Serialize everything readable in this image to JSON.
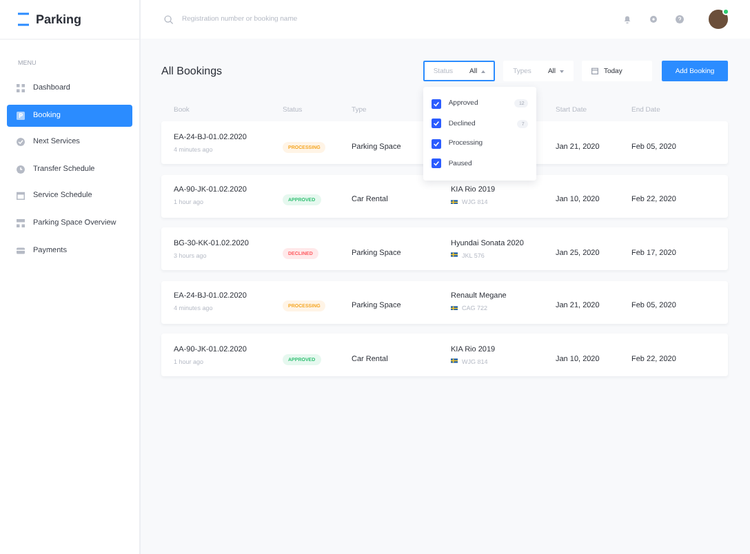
{
  "app": {
    "name": "Parking"
  },
  "search": {
    "placeholder": "Registration number or booking name"
  },
  "avatar": {
    "online": true
  },
  "sidebar": {
    "heading": "MENU",
    "items": [
      {
        "label": "Dashboard",
        "kind": "grid",
        "selected": false
      },
      {
        "label": "Booking",
        "kind": "parking",
        "selected": true
      },
      {
        "label": "Next Services",
        "kind": "check",
        "selected": false
      },
      {
        "label": "Transfer Schedule",
        "kind": "clock",
        "selected": false
      },
      {
        "label": "Service Schedule",
        "kind": "calendar",
        "selected": false
      },
      {
        "label": "Parking Space Overview",
        "kind": "layout",
        "selected": false
      },
      {
        "label": "Payments",
        "kind": "card",
        "selected": false
      }
    ]
  },
  "page": {
    "title": "All Bookings"
  },
  "filters": {
    "status": {
      "label": "Status",
      "value": "All",
      "expanded": true
    },
    "types": {
      "label": "Types",
      "value": "All",
      "expanded": false
    },
    "date": {
      "value": "Today"
    },
    "add_button": "Add Booking"
  },
  "status_options": [
    {
      "label": "Approved",
      "checked": true,
      "count": "12"
    },
    {
      "label": "Declined",
      "checked": true,
      "count": "7"
    },
    {
      "label": "Processing",
      "checked": true
    },
    {
      "label": "Paused",
      "checked": true
    }
  ],
  "table": {
    "columns": [
      "Book",
      "Status",
      "Type",
      "Start Date",
      "End Date"
    ],
    "rows": [
      {
        "book": "EA-24-BJ-01.02.2020",
        "time": "4 minutes ago",
        "status": "PROCESSING",
        "kind": "processing",
        "type": "Parking Space",
        "start": "Jan 21, 2020",
        "end": "Feb 05, 2020"
      },
      {
        "book": "AA-90-JK-01.02.2020",
        "time": "1 hour ago",
        "status": "APPROVED",
        "kind": "approved",
        "type": "Car Rental",
        "car": {
          "model": "KIA Rio 2019",
          "plate": "WJG 814"
        },
        "start": "Jan 10, 2020",
        "end": "Feb 22, 2020"
      },
      {
        "book": "BG-30-KK-01.02.2020",
        "time": "3 hours ago",
        "status": "DECLINED",
        "kind": "declined",
        "type": "Parking Space",
        "car": {
          "model": "Hyundai Sonata 2020",
          "plate": "JKL 576"
        },
        "start": "Jan 25, 2020",
        "end": "Feb 17, 2020"
      },
      {
        "book": "EA-24-BJ-01.02.2020",
        "time": "4 minutes ago",
        "status": "PROCESSING",
        "kind": "processing",
        "type": "Parking Space",
        "car": {
          "model": "Renault Megane",
          "plate": "CAG 722"
        },
        "start": "Jan 21, 2020",
        "end": "Feb 05, 2020"
      },
      {
        "book": "AA-90-JK-01.02.2020",
        "time": "1 hour ago",
        "status": "APPROVED",
        "kind": "approved",
        "type": "Car Rental",
        "car": {
          "model": "KIA Rio 2019",
          "plate": "WJG 814"
        },
        "start": "Jan 10, 2020",
        "end": "Feb 22, 2020"
      }
    ]
  }
}
